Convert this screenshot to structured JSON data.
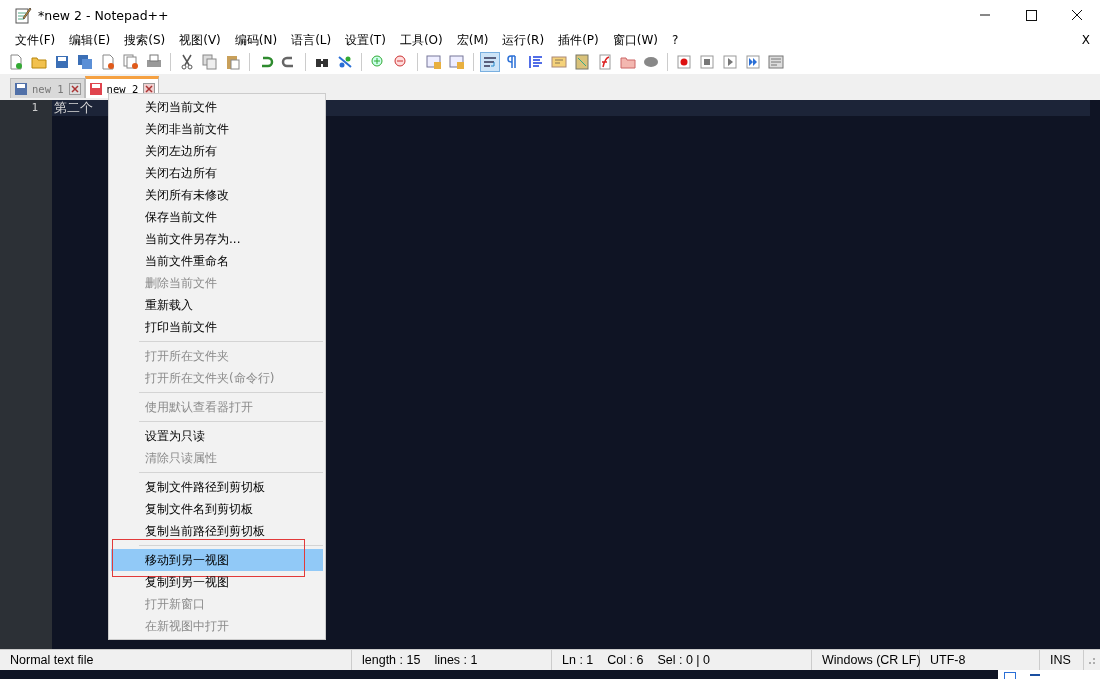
{
  "window": {
    "title": "*new 2 - Notepad++"
  },
  "menu_bar": [
    "文件(F)",
    "编辑(E)",
    "搜索(S)",
    "视图(V)",
    "编码(N)",
    "语言(L)",
    "设置(T)",
    "工具(O)",
    "宏(M)",
    "运行(R)",
    "插件(P)",
    "窗口(W)",
    "?"
  ],
  "menu_close": "X",
  "toolbar": [
    {
      "kind": "new",
      "selected": false
    },
    {
      "kind": "open",
      "selected": false
    },
    {
      "kind": "save",
      "selected": false
    },
    {
      "kind": "saveall",
      "selected": false
    },
    {
      "kind": "close",
      "selected": false
    },
    {
      "kind": "closeall",
      "selected": false
    },
    {
      "kind": "print",
      "selected": false
    },
    {
      "kind": "sep"
    },
    {
      "kind": "cut",
      "selected": false
    },
    {
      "kind": "copy",
      "selected": false
    },
    {
      "kind": "paste",
      "selected": false
    },
    {
      "kind": "sep"
    },
    {
      "kind": "undo",
      "selected": false
    },
    {
      "kind": "redo",
      "selected": false
    },
    {
      "kind": "sep"
    },
    {
      "kind": "find",
      "selected": false
    },
    {
      "kind": "replace",
      "selected": false
    },
    {
      "kind": "sep"
    },
    {
      "kind": "zoomin",
      "selected": false
    },
    {
      "kind": "zoomout",
      "selected": false
    },
    {
      "kind": "sep"
    },
    {
      "kind": "syncv",
      "selected": false
    },
    {
      "kind": "synch",
      "selected": false
    },
    {
      "kind": "sep"
    },
    {
      "kind": "wrap",
      "selected": true
    },
    {
      "kind": "pilcrow",
      "selected": false
    },
    {
      "kind": "indent",
      "selected": false
    },
    {
      "kind": "udl",
      "selected": false
    },
    {
      "kind": "docmap",
      "selected": false
    },
    {
      "kind": "function",
      "selected": false
    },
    {
      "kind": "folder",
      "selected": false
    },
    {
      "kind": "monitor",
      "selected": false
    },
    {
      "kind": "sep"
    },
    {
      "kind": "record",
      "selected": false
    },
    {
      "kind": "stop",
      "selected": false
    },
    {
      "kind": "play",
      "selected": false
    },
    {
      "kind": "playmulti",
      "selected": false
    },
    {
      "kind": "savemacro",
      "selected": false
    }
  ],
  "tabs": [
    {
      "label": "new 1",
      "selected": false,
      "modified": false
    },
    {
      "label": "new 2",
      "selected": true,
      "modified": true
    }
  ],
  "editor": {
    "line_numbers": [
      "1"
    ],
    "lines": [
      "第二个"
    ]
  },
  "context_menu": [
    {
      "kind": "item",
      "label": "关闭当前文件",
      "disabled": false,
      "selected": false
    },
    {
      "kind": "item",
      "label": "关闭非当前文件",
      "disabled": false,
      "selected": false
    },
    {
      "kind": "item",
      "label": "关闭左边所有",
      "disabled": false,
      "selected": false
    },
    {
      "kind": "item",
      "label": "关闭右边所有",
      "disabled": false,
      "selected": false
    },
    {
      "kind": "item",
      "label": "关闭所有未修改",
      "disabled": false,
      "selected": false
    },
    {
      "kind": "item",
      "label": "保存当前文件",
      "disabled": false,
      "selected": false
    },
    {
      "kind": "item",
      "label": "当前文件另存为...",
      "disabled": false,
      "selected": false
    },
    {
      "kind": "item",
      "label": "当前文件重命名",
      "disabled": false,
      "selected": false
    },
    {
      "kind": "item",
      "label": "删除当前文件",
      "disabled": true,
      "selected": false
    },
    {
      "kind": "item",
      "label": "重新载入",
      "disabled": false,
      "selected": false
    },
    {
      "kind": "item",
      "label": "打印当前文件",
      "disabled": false,
      "selected": false
    },
    {
      "kind": "separator"
    },
    {
      "kind": "item",
      "label": "打开所在文件夹",
      "disabled": true,
      "selected": false
    },
    {
      "kind": "item",
      "label": "打开所在文件夹(命令行)",
      "disabled": true,
      "selected": false
    },
    {
      "kind": "separator"
    },
    {
      "kind": "item",
      "label": "使用默认查看器打开",
      "disabled": true,
      "selected": false
    },
    {
      "kind": "separator"
    },
    {
      "kind": "item",
      "label": "设置为只读",
      "disabled": false,
      "selected": false
    },
    {
      "kind": "item",
      "label": "清除只读属性",
      "disabled": true,
      "selected": false
    },
    {
      "kind": "separator"
    },
    {
      "kind": "item",
      "label": "复制文件路径到剪切板",
      "disabled": false,
      "selected": false
    },
    {
      "kind": "item",
      "label": "复制文件名到剪切板",
      "disabled": false,
      "selected": false
    },
    {
      "kind": "item",
      "label": "复制当前路径到剪切板",
      "disabled": false,
      "selected": false
    },
    {
      "kind": "separator"
    },
    {
      "kind": "item",
      "label": "移动到另一视图",
      "disabled": false,
      "selected": true,
      "annotated": true
    },
    {
      "kind": "item",
      "label": "复制到另一视图",
      "disabled": false,
      "selected": false
    },
    {
      "kind": "item",
      "label": "打开新窗口",
      "disabled": true,
      "selected": false
    },
    {
      "kind": "item",
      "label": "在新视图中打开",
      "disabled": true,
      "selected": false
    }
  ],
  "status_bar": [
    [
      "Normal text file"
    ],
    [
      "length : 15",
      "lines : 1"
    ],
    [
      "Ln : 1",
      "Col : 6",
      "Sel : 0 | 0"
    ],
    [
      "Windows (CR LF)"
    ],
    [
      "UTF-8"
    ],
    [
      "INS"
    ]
  ]
}
